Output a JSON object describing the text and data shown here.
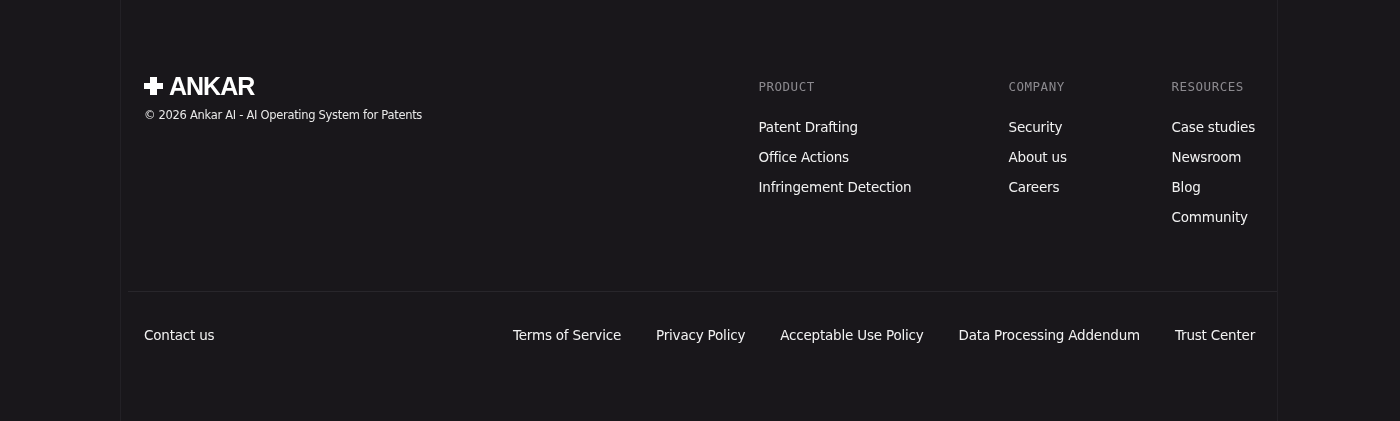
{
  "brand": {
    "name": "ANKAR",
    "copyright": "© 2026 Ankar AI - AI Operating System for Patents"
  },
  "columns": [
    {
      "heading": "PRODUCT",
      "links": [
        "Patent Drafting",
        "Office Actions",
        "Infringement Detection"
      ]
    },
    {
      "heading": "COMPANY",
      "links": [
        "Security",
        "About us",
        "Careers"
      ]
    },
    {
      "heading": "RESOURCES",
      "links": [
        "Case studies",
        "Newsroom",
        "Blog",
        "Community"
      ]
    }
  ],
  "contact": "Contact us",
  "legal_links": [
    "Terms of Service",
    "Privacy Policy",
    "Acceptable Use Policy",
    "Data Processing Addendum",
    "Trust Center"
  ]
}
